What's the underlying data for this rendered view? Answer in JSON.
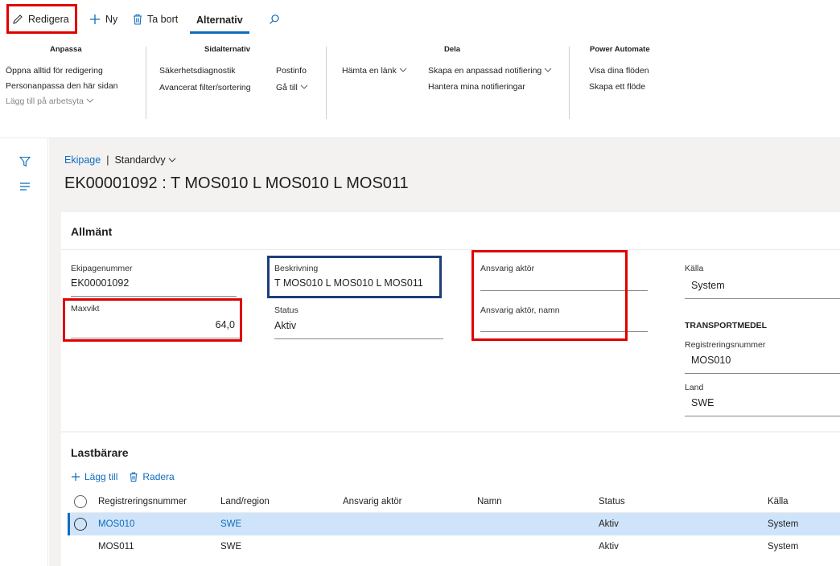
{
  "actionbar": {
    "edit_label": "Redigera",
    "new_label": "Ny",
    "delete_label": "Ta bort",
    "options_tab": "Alternativ"
  },
  "ribbon": {
    "groups": [
      {
        "title": "Anpassa",
        "items": [
          "Öppna alltid för redigering",
          "Personanpassa den här sidan",
          "Lägg till på arbetsyta"
        ]
      },
      {
        "title": "Sidalternativ",
        "items": [
          "Säkerhetsdiagnostik",
          "Avancerat filter/sortering",
          "Postinfo",
          "Gå till"
        ]
      },
      {
        "title": "Dela",
        "items": [
          "Hämta en länk",
          "Skapa en anpassad notifiering",
          "Hantera mina notifieringar"
        ]
      },
      {
        "title": "Power Automate",
        "items": [
          "Visa dina flöden",
          "Skapa ett flöde"
        ]
      }
    ]
  },
  "breadcrumb": {
    "link": "Ekipage",
    "separator": "|",
    "view": "Standardvy"
  },
  "page_title": "EK00001092 : T MOS010 L MOS010 L MOS011",
  "general": {
    "header": "Allmänt",
    "ekipagenummer": {
      "label": "Ekipagenummer",
      "value": "EK00001092"
    },
    "maxvikt": {
      "label": "Maxvikt",
      "value": "64,0"
    },
    "beskrivning": {
      "label": "Beskrivning",
      "value": "T MOS010 L MOS010 L MOS011"
    },
    "status": {
      "label": "Status",
      "value": "Aktiv"
    },
    "ansvarig_aktor": {
      "label": "Ansvarig aktör",
      "value": ""
    },
    "ansvarig_aktor_namn": {
      "label": "Ansvarig aktör, namn",
      "value": ""
    },
    "kalla": {
      "label": "Källa",
      "value": "System"
    },
    "transportmedel_header": "TRANSPORTMEDEL",
    "registreringsnummer": {
      "label": "Registreringsnummer",
      "value": "MOS010"
    },
    "land": {
      "label": "Land",
      "value": "SWE"
    }
  },
  "carriers": {
    "header": "Lastbärare",
    "add_label": "Lägg till",
    "delete_label": "Radera",
    "columns": [
      "Registreringsnummer",
      "Land/region",
      "Ansvarig aktör",
      "Namn",
      "Status",
      "Källa"
    ],
    "rows": [
      {
        "reg": "MOS010",
        "land": "SWE",
        "aktor": "",
        "namn": "",
        "status": "Aktiv",
        "kalla": "System",
        "selected": true
      },
      {
        "reg": "MOS011",
        "land": "SWE",
        "aktor": "",
        "namn": "",
        "status": "Aktiv",
        "kalla": "System",
        "selected": false
      }
    ]
  },
  "colors": {
    "accent": "#0f6cbd",
    "highlight_red": "#e00000",
    "highlight_blue": "#1f3e7a",
    "selected_row": "#cfe4fa"
  }
}
